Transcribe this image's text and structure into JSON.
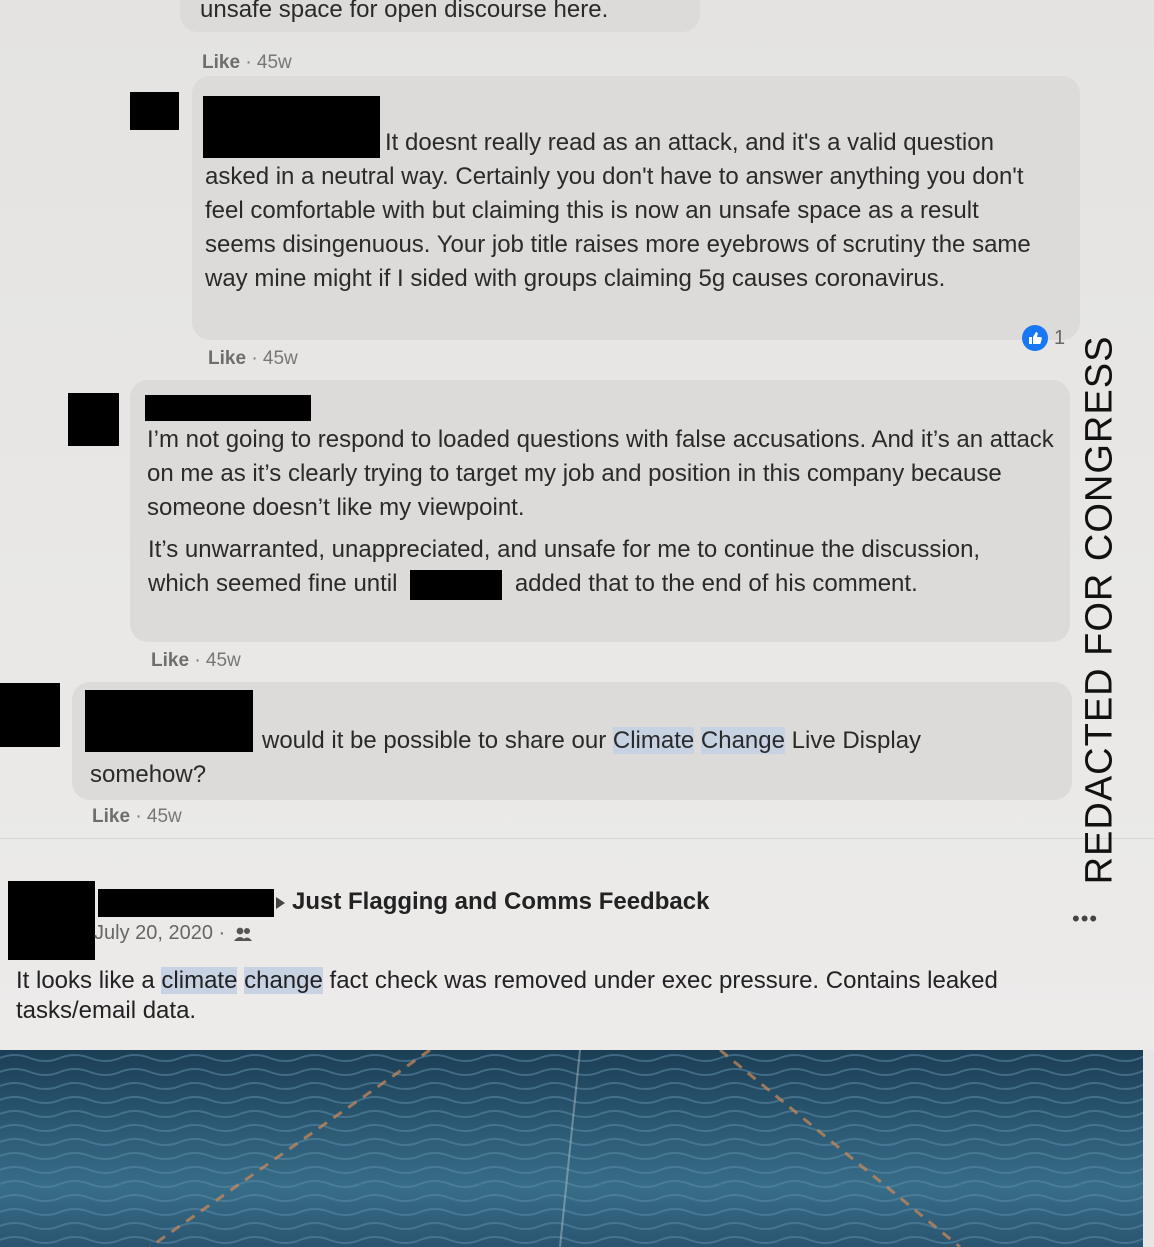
{
  "comments": [
    {
      "partial_text": "unsafe space for open discourse here.",
      "like_label": "Like",
      "time": "45w"
    },
    {
      "text": "It doesnt really read as an attack, and it's a valid question asked in a neutral way. Certainly you don't have to answer anything you don't feel comfortable with but claiming this is now an unsafe space as a result seems disingenuous. Your job title raises more eyebrows of scrutiny the same way mine might if I sided with groups claiming 5g causes coronavirus.",
      "like_label": "Like",
      "time": "45w",
      "reaction_count": "1"
    },
    {
      "paragraph1": "I’m not going to respond to loaded questions with false accusations. And it’s an attack on me as it’s clearly trying to target my job and position in this company because someone doesn’t like my viewpoint.",
      "paragraph2_before": "It’s unwarranted, unappreciated, and unsafe for me to continue the discussion, which seemed fine until",
      "paragraph2_after": "added that to the end of his comment.",
      "like_label": "Like",
      "time": "45w"
    },
    {
      "text_before": "would it be possible to share our",
      "highlight1": "Climate",
      "highlight2": "Change",
      "text_after": "Live Display somehow?",
      "like_label": "Like",
      "time": "45w"
    }
  ],
  "post": {
    "group": "Just Flagging and Comms Feedback",
    "date": "July 20, 2020 ·",
    "body_before": "It looks like a",
    "highlight1": "climate",
    "highlight2": "change",
    "body_after": "fact check was removed under exec pressure. Contains leaked tasks/email data."
  },
  "watermark": "REDACTED FOR CONGRESS",
  "colors": {
    "like_badge": "#1877f2",
    "highlight": "#c7d3e3",
    "redaction": "#000000"
  }
}
